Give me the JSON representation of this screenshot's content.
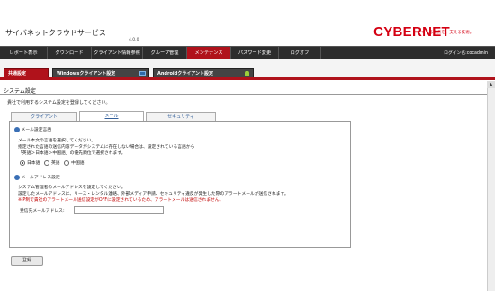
{
  "header": {
    "app_title": "サイバネットクラウドサービス",
    "version": "4.0.0",
    "brand": "CYBERNET",
    "tagline": "つくる情熱を、支える技術。",
    "login_info": "ログイン名:cocadmin"
  },
  "nav": {
    "items": [
      {
        "label": "レポート表示"
      },
      {
        "label": "ダウンロード"
      },
      {
        "label": "クライアント情報参照"
      },
      {
        "label": "グループ管理"
      },
      {
        "label": "メンテナンス"
      },
      {
        "label": "パスワード変更"
      },
      {
        "label": "ログオフ"
      }
    ],
    "active": "メンテナンス"
  },
  "subtabs": {
    "items": [
      {
        "label": "共通設定"
      },
      {
        "label": "Windowsクライアント設定"
      },
      {
        "label": "Androidクライアント設定"
      }
    ]
  },
  "section": {
    "title": "システム設定",
    "description": "貴社で利用するシステム設定を登録してください。"
  },
  "panel_tabs": [
    {
      "label": "クライアント"
    },
    {
      "label": "メール"
    },
    {
      "label": "セキュリティ"
    }
  ],
  "mail_language": {
    "heading": "メール設定言語",
    "lines": [
      "メール本文の言語を選択してください。",
      "指定された言語の送信内容データがシステムに存在しない場合は、設定されている言語から",
      "「英語＞日本語＞中国語」の優先順位で選択されます。"
    ],
    "options": [
      "日本語",
      "英語",
      "中国語"
    ],
    "selected": "日本語"
  },
  "admin_email": {
    "heading": "メールアドレス設定",
    "lines": [
      "システム管理者のメールアドレスを設定してください。",
      "設定したメールアドレスに、リース・レンタル連絡、外部メディア申請、セキュリティ違反が発生した際のアラートメールが送信されます。"
    ],
    "warning": "※IP制で貴社のアラートメール送信設定がOFFに設定されているため、アラートメールは送信されません。",
    "field_label": "受信先メールアドレス:",
    "field_value": ""
  },
  "apply_button": "登録"
}
